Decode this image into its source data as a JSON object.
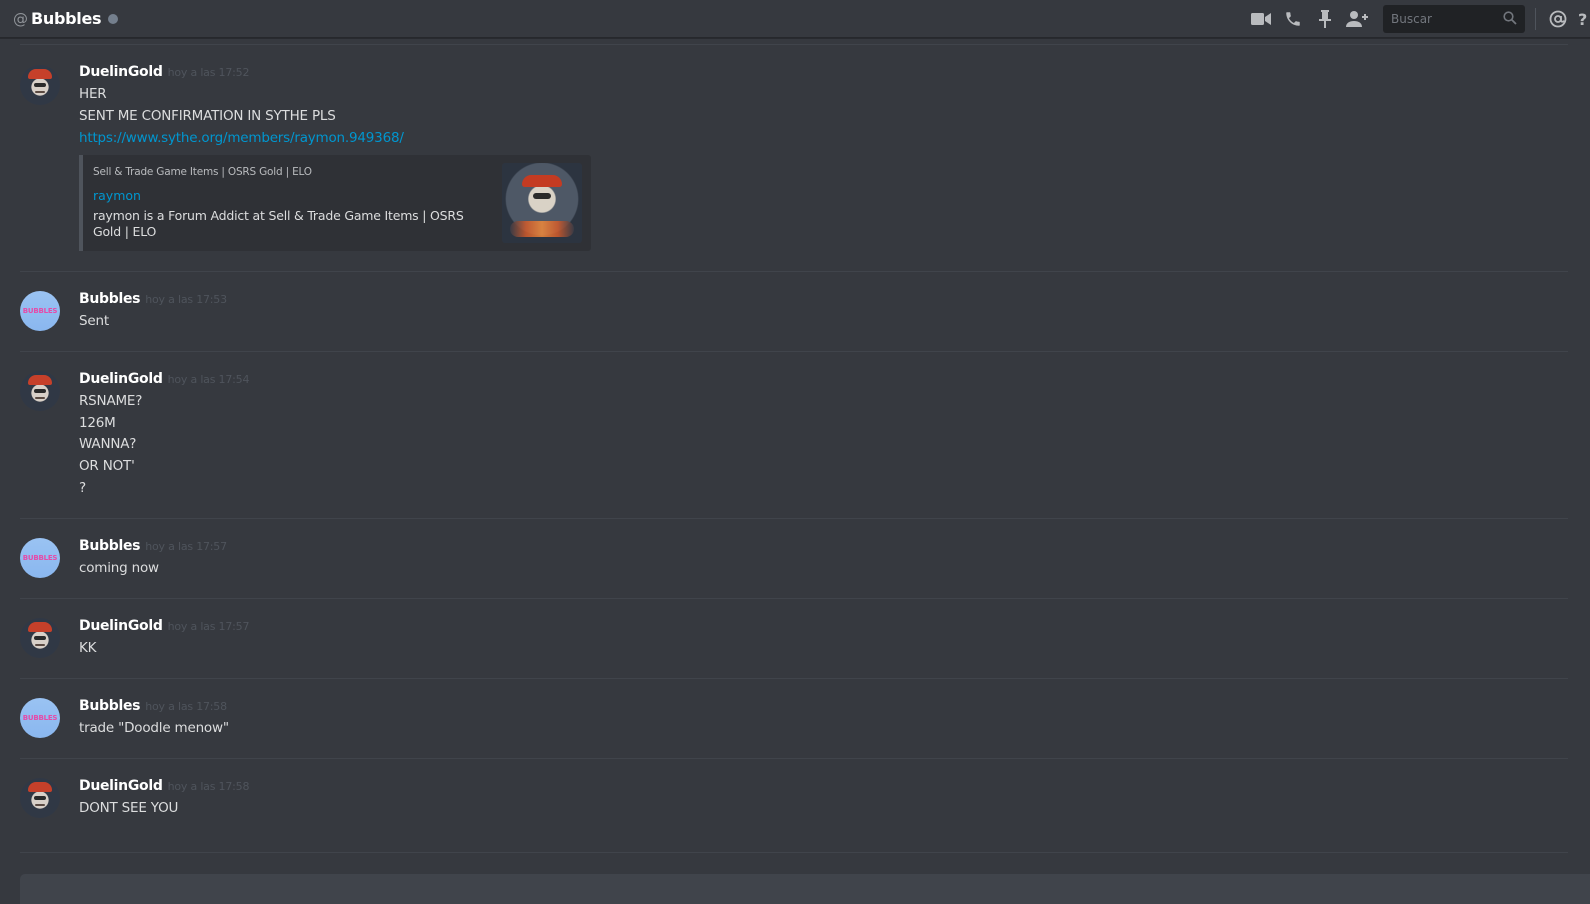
{
  "header": {
    "at_symbol": "@",
    "title": "Bubbles",
    "search_placeholder": "Buscar",
    "icons": [
      "video-icon",
      "phone-icon",
      "pin-icon",
      "add-friend-icon",
      "search-icon",
      "mention-icon",
      "help-icon"
    ],
    "help_glyph": "?"
  },
  "colors": {
    "background": "#36393f",
    "link": "#0096cf",
    "username": "#ffffff",
    "timestamp": "#4f545c"
  },
  "messages": [
    {
      "author": "DuelinGold",
      "time": "hoy a las 17:52",
      "lines": [
        "HER",
        "SENT ME CONFIRMATION IN SYTHE PLS"
      ],
      "link": "https://www.sythe.org/members/raymon.949368/",
      "embed": {
        "provider": "Sell & Trade Game Items | OSRS Gold | ELO",
        "title": "raymon",
        "description": "raymon is a Forum Addict at Sell & Trade Game Items | OSRS Gold | ELO"
      }
    },
    {
      "author": "Bubbles",
      "avatar_text": "BUBBLES",
      "time": "hoy a las 17:53",
      "lines": [
        "Sent"
      ]
    },
    {
      "author": "DuelinGold",
      "time": "hoy a las 17:54",
      "lines": [
        "RSNAME?",
        "126M",
        "WANNA?",
        "OR NOT'",
        "?"
      ]
    },
    {
      "author": "Bubbles",
      "avatar_text": "BUBBLES",
      "time": "hoy a las 17:57",
      "lines": [
        "coming now"
      ]
    },
    {
      "author": "DuelinGold",
      "time": "hoy a las 17:57",
      "lines": [
        "KK"
      ]
    },
    {
      "author": "Bubbles",
      "avatar_text": "BUBBLES",
      "time": "hoy a las 17:58",
      "lines": [
        "trade \"Doodle menow\""
      ]
    },
    {
      "author": "DuelinGold",
      "time": "hoy a las 17:58",
      "lines": [
        "DONT SEE YOU"
      ]
    }
  ]
}
